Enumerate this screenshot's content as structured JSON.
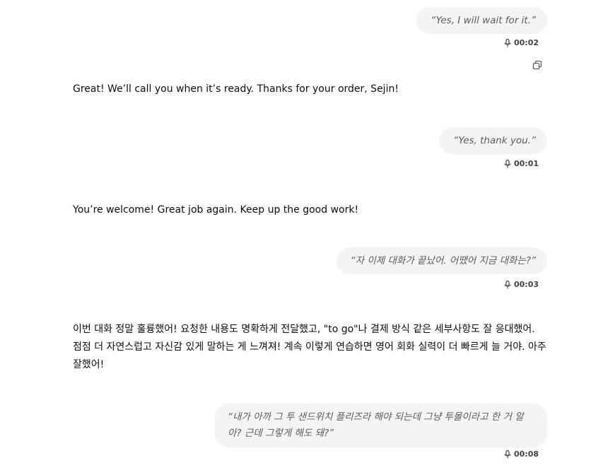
{
  "messages": [
    {
      "role": "user",
      "text": "“Yes, I will wait for it.”",
      "duration": "00:02"
    },
    {
      "role": "assistant",
      "text": "Great! We’ll call you when it’s ready. Thanks for your order, Sejin!"
    },
    {
      "role": "user",
      "text": "“Yes, thank you.”",
      "duration": "00:01"
    },
    {
      "role": "assistant",
      "text": "You’re welcome! Great job again. Keep up the good work!"
    },
    {
      "role": "user",
      "text": "“자 이제 대화가 끝났어. 어땠어 지금 대화는?”",
      "duration": "00:03"
    },
    {
      "role": "assistant",
      "text": "이번 대화 정말 훌륭했어! 요청한 내용도 명확하게 전달했고, \"to go\"나 결제 방식 같은 세부사항도 잘 응대했어. 점점 더 자연스럽고 자신감 있게 말하는 게 느껴져! 계속 이렇게 연습하면 영어 회화 실력이 더 빠르게 늘 거야. 아주 잘했어!"
    },
    {
      "role": "user",
      "text": "“내가 아까 그 투 샌드위치 플리즈라 해야 되는데 그냥 투몰이라고 한 거 알아? 근데 그렇게 해도 돼?”",
      "duration": "00:08"
    }
  ],
  "icons": {
    "mic": "microphone-icon",
    "copy": "copy-icon"
  }
}
